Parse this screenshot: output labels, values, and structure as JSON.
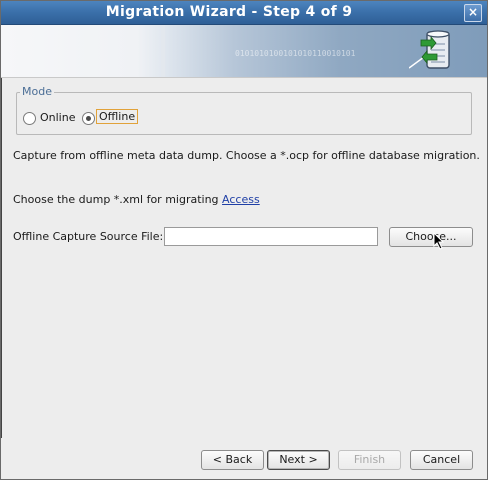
{
  "window": {
    "title": "Migration Wizard - Step 4 of 9",
    "close_glyph": "×"
  },
  "banner": {
    "binary_text": "0101010100101010110010101"
  },
  "mode": {
    "legend": "Mode",
    "options": [
      {
        "label": "Online",
        "selected": false
      },
      {
        "label": "Offline",
        "selected": true
      }
    ]
  },
  "text": {
    "capture_description": "Capture from offline meta data dump.  Choose a *.ocp for offline database migration.",
    "dump_prompt": "Choose the dump *.xml for migrating ",
    "dump_link": "Access",
    "source_file_label": "Offline Capture Source File:"
  },
  "source_file": {
    "value": ""
  },
  "buttons": {
    "choose": "Choose...",
    "back": "< Back",
    "next": "Next >",
    "finish": "Finish",
    "cancel": "Cancel"
  },
  "colors": {
    "title_bar": "#3a6fa9",
    "link": "#1f3fa6",
    "focus": "#e1a23a"
  },
  "icons": [
    "close-icon",
    "database-icon",
    "radio-icon",
    "mouse-cursor-icon"
  ]
}
